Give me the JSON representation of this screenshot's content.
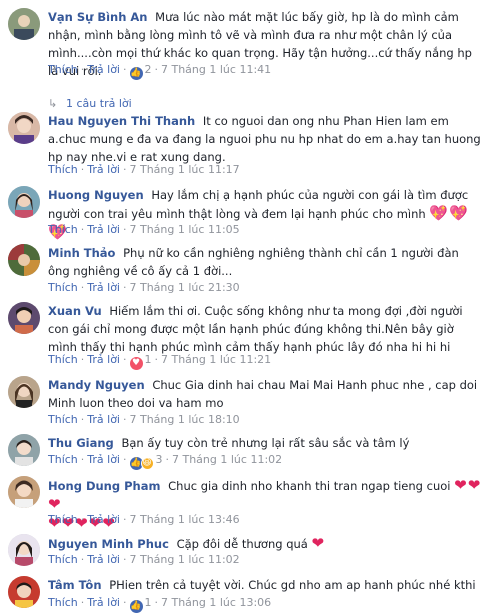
{
  "actions": {
    "like": "Thích",
    "reply": "Trả lời",
    "dot": "·"
  },
  "comments": [
    {
      "author": "Vạn Sự Bình An",
      "text": "Mưa lúc nào mát mặt lúc bấy giờ, hp là do mình cảm nhận, mình bằng lòng mình tô vẽ và mình đưa ra như một chân lý của mình....còn mọi thứ khác ko quan trọng. Hãy tận hưởng...cứ thấy nắng hp là vui rồi.",
      "reaction_count": "2",
      "time": "7 Tháng 1 lúc 11:41",
      "replies_link": "1 câu trả lời"
    },
    {
      "author": "Hau Nguyen Thi Thanh",
      "text": "It co nguoi dan ong nhu Phan Hien lam em a.chuc mung e đa va đang la nguoi phu nu hp nhat do em a.hay tan huong hp nay nhe.vi e rat xung dang.",
      "time": "7 Tháng 1 lúc 11:17"
    },
    {
      "author": "Huong Nguyen",
      "text": "Hay lắm chị ạ hạnh phúc của người con gái là tìm được người con trai yêu mình thật lòng và đem lại hạnh phúc cho mình",
      "hearts": "💖💖💖",
      "time": "7 Tháng 1 lúc 11:05"
    },
    {
      "author": "Minh Thảo",
      "text": "Phụ nữ ko cần nghiêng nghiêng thành chỉ cần 1 người đàn ông nghiêng về cô ấy cả 1 đời...",
      "time": "7 Tháng 1 lúc 21:30"
    },
    {
      "author": "Xuan Vu",
      "text": "Hiếm lắm thi ơi. Cuộc sống không như ta mong đợi ,đời người con gái chỉ mong được một lần hạnh phúc đúng không thi.Nên bây giờ mình thấy thi hạnh phúc mình cảm thấy hạnh phúc lây đó nha hi hi hi",
      "reaction_count": "1",
      "time": "7 Tháng 1 lúc 11:21"
    },
    {
      "author": "Mandy Nguyen",
      "text": "Chuc Gia dinh hai chau Mai Mai Hanh phuc nhe , cap doi Minh luon theo doi va ham mo",
      "time": "7 Tháng 1 lúc 18:10"
    },
    {
      "author": "Thu Giang",
      "text": "Bạn ấy tuy còn trẻ nhưng lại rất sâu sắc và tâm lý",
      "reaction_count": "3",
      "time": "7 Tháng 1 lúc 11:02"
    },
    {
      "author": "Hong Dung Pham",
      "text": "Chuc gia dinh nho khanh thi tran ngap tieng cuoi",
      "hearts_inline": "❤❤❤",
      "hearts_line": "❤❤❤❤❤",
      "time": "7 Tháng 1 lúc 13:46"
    },
    {
      "author": "Nguyen Minh Phuc",
      "text": "Cặp đôi dễ thương quá",
      "hearts": "❤",
      "time": "7 Tháng 1 lúc 11:02"
    },
    {
      "author": "Tâm Tôn",
      "text": "PHien trên cả tuyệt vời. Chúc gd nho am ap hanh phúc nhé kthi",
      "reaction_count": "1",
      "time": "7 Tháng 1 lúc 13:06"
    }
  ],
  "colors": {
    "author": "#365899",
    "link": "#4267b2",
    "muted": "#90949c",
    "like": "#4267b2",
    "love": "#f25268",
    "haha": "#f7b125"
  },
  "icons": [
    "like-icon",
    "love-icon",
    "haha-icon",
    "reply-arrow-icon"
  ]
}
